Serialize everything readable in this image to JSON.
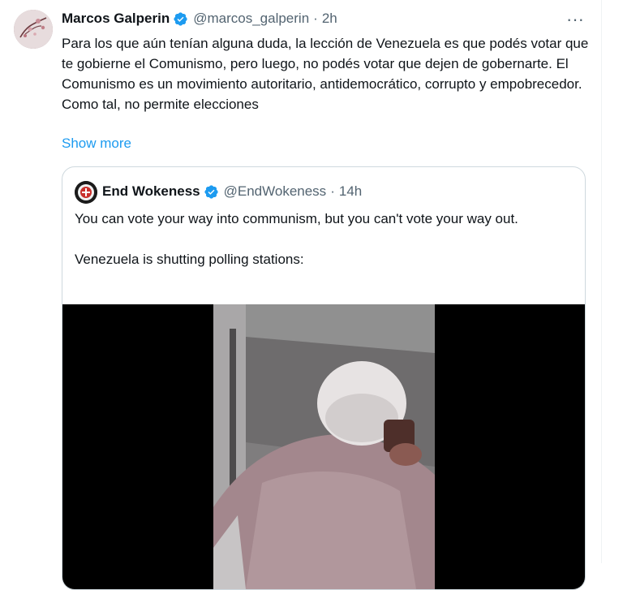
{
  "tweet": {
    "author_name": "Marcos Galperin",
    "handle": "@marcos_galperin",
    "separator": "·",
    "time": "2h",
    "text": "Para los que aún tenían alguna duda, la lección de Venezuela es que podés votar que te gobierne el Comunismo, pero luego, no podés votar que dejen de gobernarte. El Comunismo es un movimiento autoritario, antidemocrático, corrupto y empobrecedor. Como tal, no permite elecciones",
    "show_more": "Show more",
    "more_icon": "···"
  },
  "quote": {
    "author_name": "End Wokeness",
    "handle": "@EndWokeness",
    "separator": "·",
    "time": "14h",
    "text_line1": "You can vote your way into communism, but you can't vote your way out.",
    "text_line2": "Venezuela is shutting polling stations:"
  },
  "colors": {
    "link": "#1d9bf0",
    "secondary": "#536471",
    "verified": "#1d9bf0",
    "border": "#cfd9de"
  },
  "icons": [
    "verified-badge-icon",
    "more-options-icon"
  ]
}
